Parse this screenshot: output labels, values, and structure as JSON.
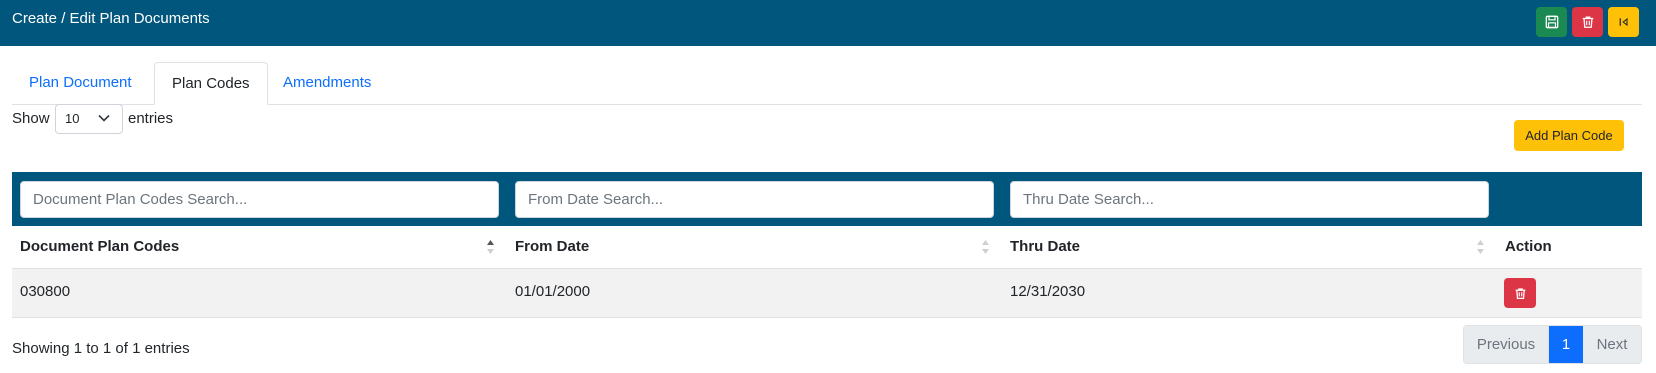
{
  "header": {
    "title": "Create / Edit Plan Documents",
    "save_icon": "floppy-disk-icon",
    "delete_icon": "trash-icon",
    "back_icon": "back-to-start-icon",
    "colors": {
      "header_bg": "#00567c",
      "save": "#1b8a52",
      "delete": "#dc3545",
      "back": "#ffc107"
    }
  },
  "tabs": [
    {
      "label": "Plan Document",
      "active": false
    },
    {
      "label": "Plan Codes",
      "active": true
    },
    {
      "label": "Amendments",
      "active": false
    }
  ],
  "length_menu": {
    "prefix": "Show",
    "selected": "10",
    "suffix": "entries"
  },
  "add_button": {
    "label": "Add Plan Code"
  },
  "search": {
    "plan_codes_placeholder": "Document Plan Codes Search...",
    "from_date_placeholder": "From Date Search...",
    "thru_date_placeholder": "Thru Date Search..."
  },
  "table": {
    "columns": [
      "Document Plan Codes",
      "From Date",
      "Thru Date",
      "Action"
    ],
    "rows": [
      {
        "plan_code": "030800",
        "from_date": "01/01/2000",
        "thru_date": "12/31/2030",
        "action_icon": "trash-icon"
      }
    ]
  },
  "info": "Showing 1 to 1 of 1 entries",
  "pagination": {
    "previous": "Previous",
    "current": "1",
    "next": "Next"
  }
}
